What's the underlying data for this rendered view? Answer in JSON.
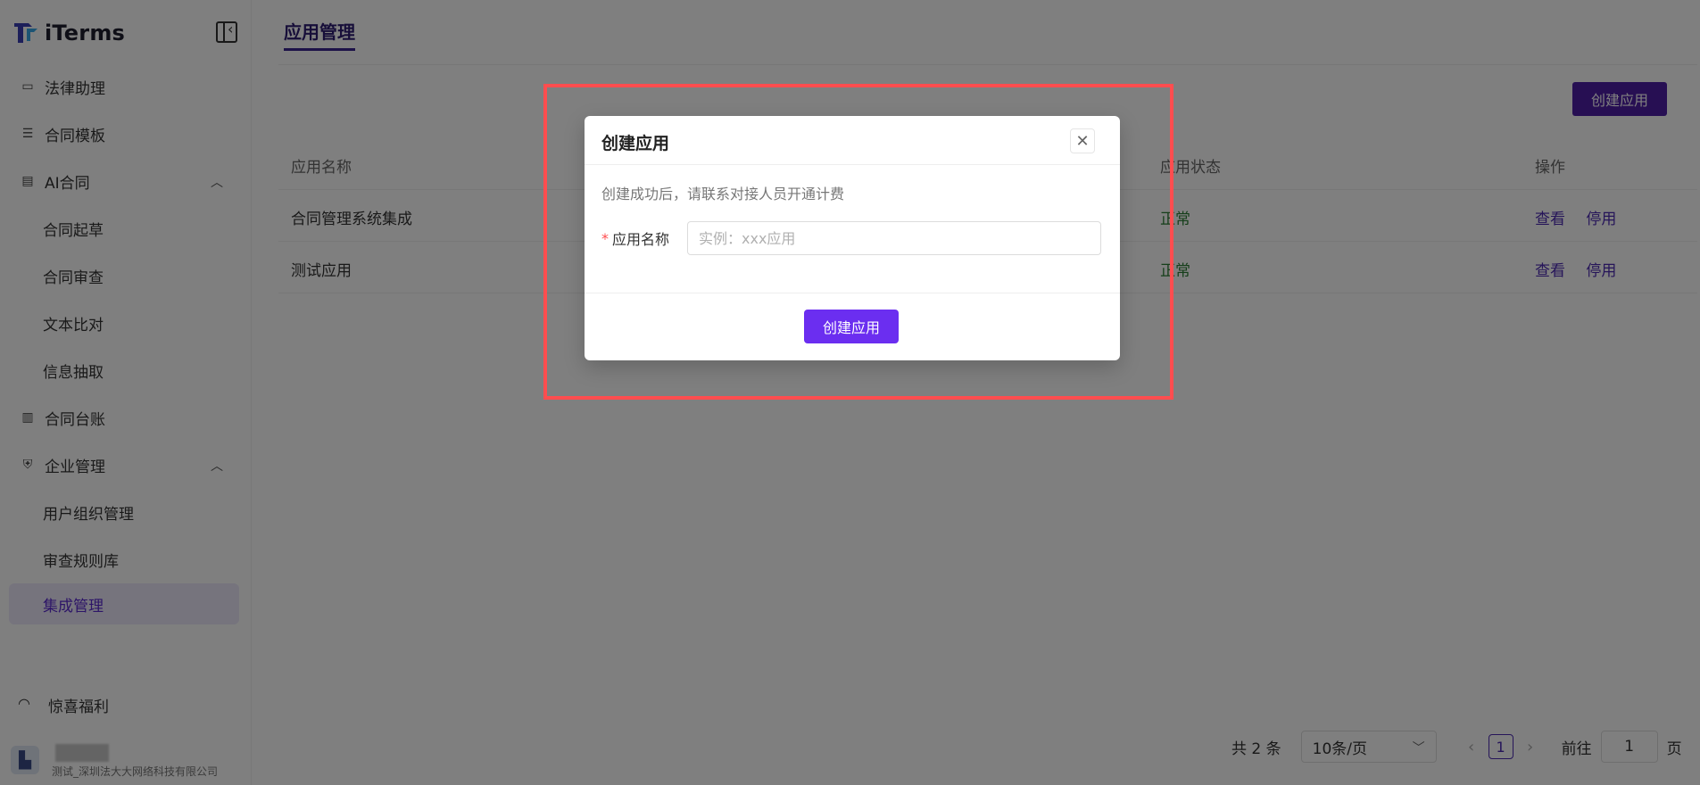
{
  "app": {
    "name": "iTerms"
  },
  "sidebar": {
    "items": [
      {
        "label": "法律助理",
        "icon": "chat-icon"
      },
      {
        "label": "合同模板",
        "icon": "archive-icon"
      },
      {
        "label": "AI合同",
        "icon": "document-icon",
        "expanded": true
      },
      {
        "label": "合同起草",
        "sub": true
      },
      {
        "label": "合同审查",
        "sub": true
      },
      {
        "label": "文本比对",
        "sub": true
      },
      {
        "label": "信息抽取",
        "sub": true
      },
      {
        "label": "合同台账",
        "icon": "book-icon"
      },
      {
        "label": "企业管理",
        "icon": "shield-icon",
        "expanded": true
      },
      {
        "label": "用户组织管理",
        "sub": true
      },
      {
        "label": "审查规则库",
        "sub": true
      },
      {
        "label": "集成管理",
        "sub": true,
        "active": true
      }
    ],
    "bottom": {
      "label": "惊喜福利"
    },
    "user": {
      "company": "测试_深圳法大大网络科技有限公司"
    }
  },
  "main": {
    "tab": "应用管理",
    "create_button": "创建应用",
    "table": {
      "headers": [
        "应用名称",
        "应用状态",
        "操作"
      ],
      "rows": [
        {
          "name": "合同管理系统集成",
          "status": "正常",
          "actions": [
            "查看",
            "停用"
          ]
        },
        {
          "name": "测试应用",
          "status": "正常",
          "actions": [
            "查看",
            "停用"
          ]
        }
      ]
    },
    "pagination": {
      "total": "共 2 条",
      "page_size": "10条/页",
      "current": "1",
      "goto": "前往",
      "goto_value": "1",
      "page_unit": "页"
    }
  },
  "modal": {
    "title": "创建应用",
    "description": "创建成功后，请联系对接人员开通计费",
    "required_mark": "*",
    "field_label": "应用名称",
    "field_placeholder": "实例：xxx应用",
    "submit": "创建应用"
  },
  "colors": {
    "accent": "#4f1ea7",
    "modal_button": "#6b2ef0",
    "highlight": "#ff4d4f",
    "status_ok": "#2a7f34"
  }
}
